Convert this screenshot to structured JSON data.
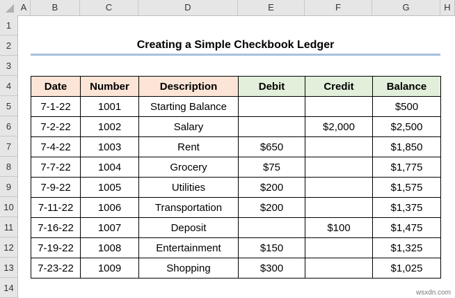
{
  "columns": [
    "A",
    "B",
    "C",
    "D",
    "E",
    "F",
    "G",
    "H"
  ],
  "rows": [
    "1",
    "2",
    "3",
    "4",
    "5",
    "6",
    "7",
    "8",
    "9",
    "10",
    "11",
    "12",
    "13",
    "14"
  ],
  "title": "Creating a Simple Checkbook Ledger",
  "headers": [
    "Date",
    "Number",
    "Description",
    "Debit",
    "Credit",
    "Balance"
  ],
  "data": [
    [
      "7-1-22",
      "1001",
      "Starting Balance",
      "",
      "",
      "$500"
    ],
    [
      "7-2-22",
      "1002",
      "Salary",
      "",
      "$2,000",
      "$2,500"
    ],
    [
      "7-4-22",
      "1003",
      "Rent",
      "$650",
      "",
      "$1,850"
    ],
    [
      "7-7-22",
      "1004",
      "Grocery",
      "$75",
      "",
      "$1,775"
    ],
    [
      "7-9-22",
      "1005",
      "Utilities",
      "$200",
      "",
      "$1,575"
    ],
    [
      "7-11-22",
      "1006",
      "Transportation",
      "$200",
      "",
      "$1,375"
    ],
    [
      "7-16-22",
      "1007",
      "Deposit",
      "",
      "$100",
      "$1,475"
    ],
    [
      "7-19-22",
      "1008",
      "Entertainment",
      "$150",
      "",
      "$1,325"
    ],
    [
      "7-23-22",
      "1009",
      "Shopping",
      "$300",
      "",
      "$1,025"
    ]
  ],
  "watermark": "wsxdn.com"
}
